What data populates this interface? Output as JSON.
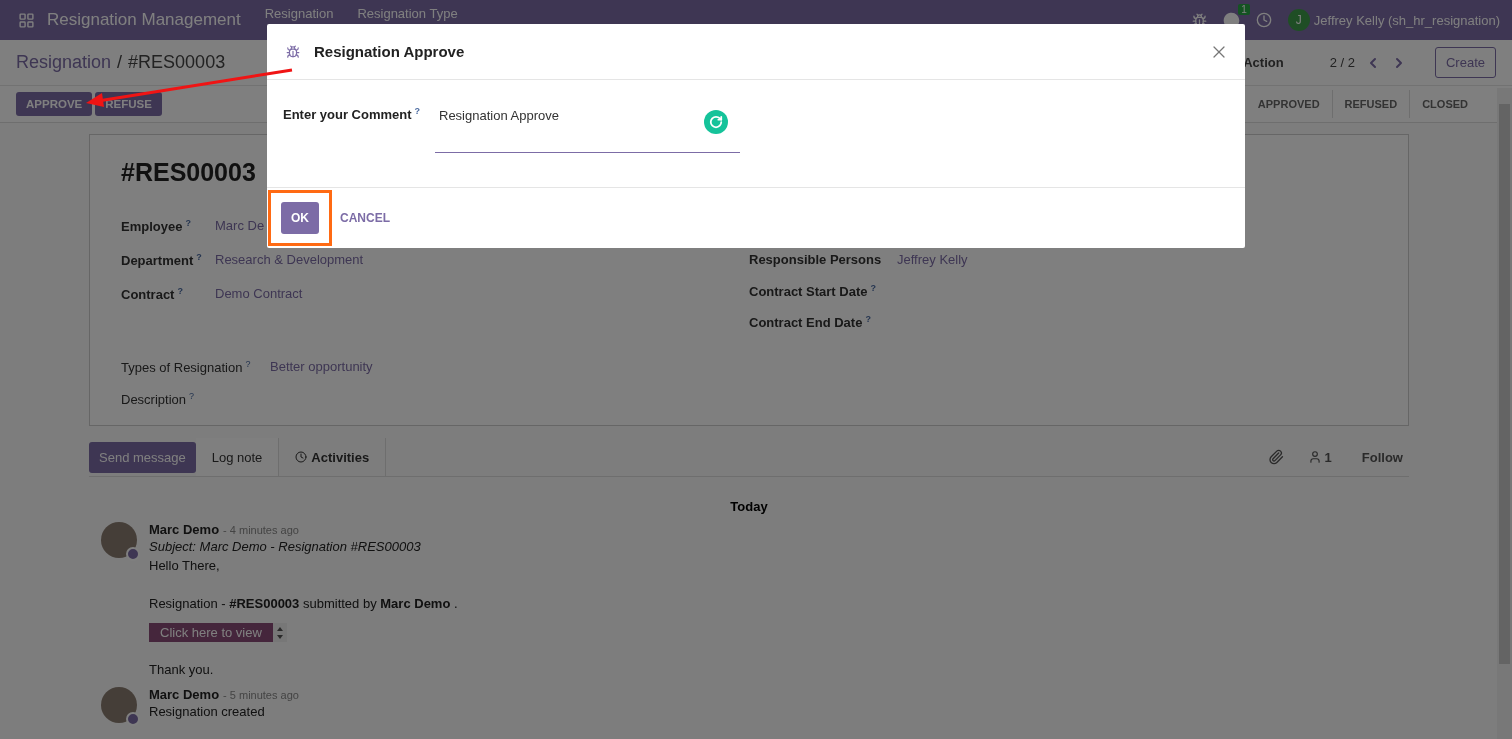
{
  "navbar": {
    "app_name": "Resignation Management",
    "menu": [
      "Resignation",
      "Resignation Type"
    ],
    "chat_count": "1",
    "user_initial": "J",
    "user_name": "Jeffrey Kelly (sh_hr_resignation)"
  },
  "control_panel": {
    "breadcrumb": [
      {
        "label": "Resignation",
        "kind": "link"
      },
      {
        "label": "/",
        "kind": "separator"
      },
      {
        "label": "#RES00003",
        "kind": "current"
      }
    ],
    "action": "Action",
    "pager": "2 / 2",
    "create": "Create",
    "buttons": [
      "APPROVE",
      "REFUSE"
    ],
    "stages": [
      {
        "label": "APPROVED",
        "selected": false
      },
      {
        "label": "REFUSED",
        "selected": false
      },
      {
        "label": "CLOSED",
        "selected": false
      }
    ]
  },
  "form": {
    "title": "#RES00003",
    "left_fields": [
      {
        "label": "Employee$^{?}$",
        "value": "Marc De"
      },
      {
        "label": "Department$^{?}$",
        "value": "Research & Development"
      },
      {
        "label": "Contract$^{?}$",
        "value": "Demo Contract"
      }
    ],
    "right_fields": [
      {
        "label": "Responsible Persons",
        "value": "Jeffrey Kelly"
      },
      {
        "label": "Contract Start Date$^{?}$"
      },
      {
        "label": "Contract End Date$^{?}$"
      }
    ],
    "bottom_fields": [
      {
        "label": "Types of Resignation$^{?}$",
        "value": "Better opportunity"
      },
      {
        "label": "Description$^{?}$"
      }
    ]
  },
  "chatter": {
    "send": "Send message",
    "tabs": [
      {
        "label": "Log note",
        "kind": "tab"
      },
      {
        "label": "Activities",
        "kind": "activities"
      }
    ],
    "followers": "1",
    "follow": "Follow",
    "date": "Today",
    "messages": [
      {
        "author": "Marc Demo",
        "time": "- 4 minutes ago",
        "lines": [
          {
            "kind": "subject",
            "text": "Subject: Marc Demo - Resignation #RES00003"
          },
          {
            "kind": "text",
            "text": "Hello There,"
          },
          {
            "kind": "gap"
          },
          {
            "kind": "text",
            "text": "Resignation - **#RES00003** submitted by **Marc Demo** ."
          },
          {
            "kind": "button",
            "text": "Click here to view"
          },
          {
            "kind": "text",
            "text": "Thank you."
          }
        ]
      },
      {
        "author": "Marc Demo",
        "time": "- 5 minutes ago",
        "lines": [
          {
            "kind": "text",
            "text": "Resignation created"
          }
        ]
      }
    ]
  },
  "dialog": {
    "title": "Resignation Approve",
    "field_label": "Enter your Comment$^{?}$",
    "value": "Resignation Approve",
    "buttons": [
      {
        "label": "OK",
        "kind": "primary"
      },
      {
        "label": "CANCEL",
        "kind": "link"
      }
    ]
  }
}
